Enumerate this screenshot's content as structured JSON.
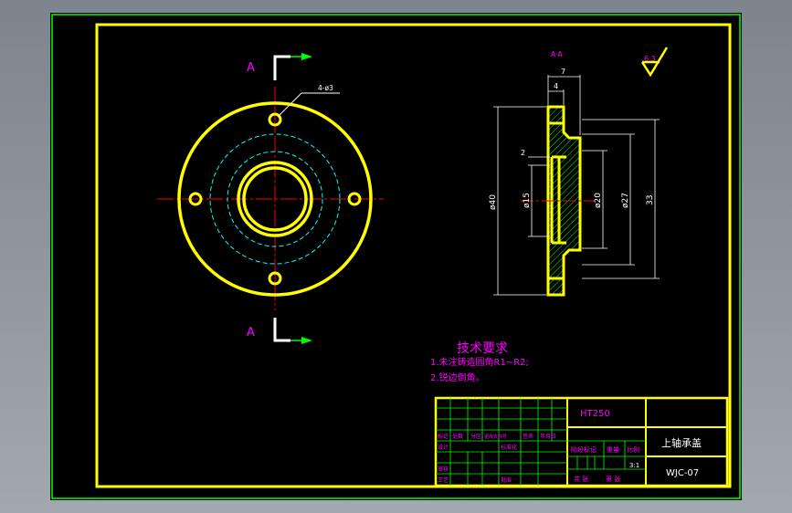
{
  "section_marks": {
    "top_letter": "A",
    "bottom_letter": "A",
    "section_title": "A-A"
  },
  "front_view": {
    "hole_callout": "4-ø3"
  },
  "section_view": {
    "dim_7": "7",
    "dim_4": "4",
    "dim_2": "2",
    "dim_d40": "ø40",
    "dim_d15": "ø15",
    "dim_d20": "ø20",
    "dim_d27": "ø27",
    "dim_33": "33"
  },
  "roughness": {
    "value": "6.3"
  },
  "tech_requirements": {
    "title": "技术要求",
    "line1": "1.未注铸造圆角R1~R2;",
    "line2": "2.锐边倒角。"
  },
  "title_block": {
    "material": "HT250",
    "part_name": "上轴承盖",
    "drawing_number": "WJC-07",
    "scale": "3:1",
    "labels": {
      "biaoji": "标记",
      "chushu": "处数",
      "fenqu": "分区",
      "gengai_wenjian": "更改文件号",
      "qianming": "签名",
      "nianyueri": "年月日",
      "sheji": "设计",
      "biaozhunhua": "标准化",
      "shenhe": "审核",
      "gongyi": "工艺",
      "pizhun": "批准",
      "jieduan_biaoji": "阶段标记",
      "zhongliang": "重量",
      "bili": "比例",
      "gong_zhang": "共 张",
      "di_zhang": "第 张"
    }
  },
  "colors": {
    "background": "#000000",
    "frame": "#ffff00",
    "outer_border": "#00ff00",
    "text": "#ff00ff",
    "center_line": "#ff0000",
    "hidden": "#00ffff",
    "dimension": "#ffffff",
    "arrow": "#00ff00"
  }
}
